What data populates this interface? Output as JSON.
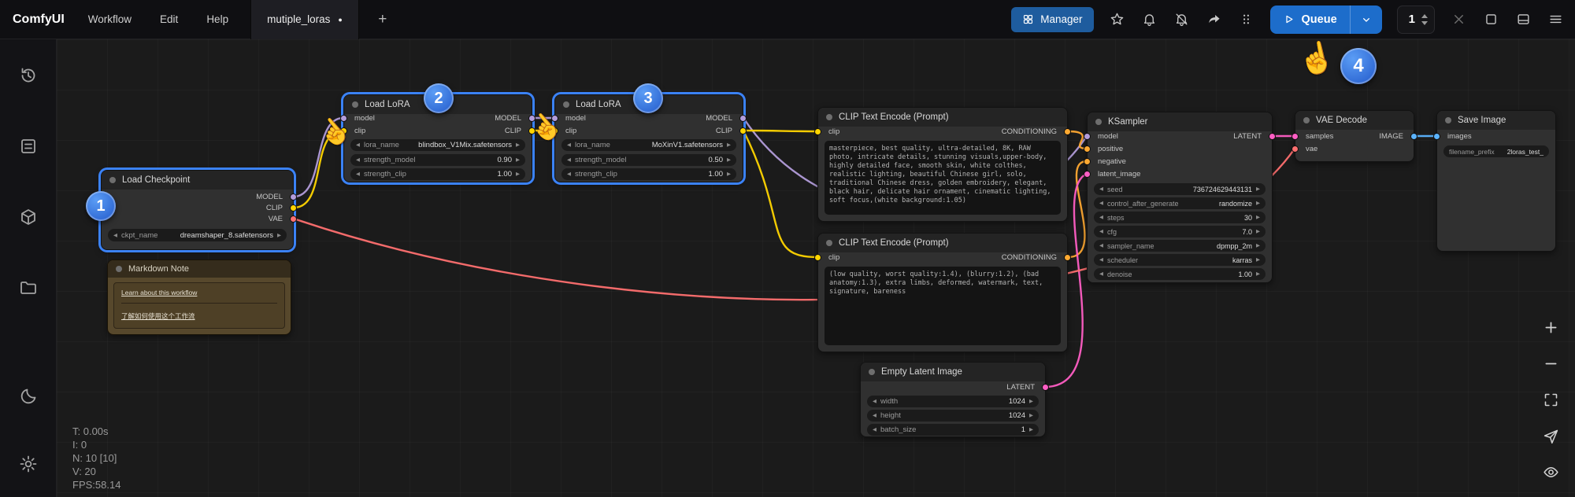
{
  "topbar": {
    "logo": "ComfyUI",
    "menus": [
      "Workflow",
      "Edit",
      "Help"
    ],
    "tab_label": "mutiple_loras",
    "tab_dirty_dot": "●",
    "new_tab_label": "+",
    "manager_label": "Manager",
    "queue_label": "Queue",
    "queue_count": "1"
  },
  "glyphs": {
    "arrow_left": "◀",
    "arrow_right": "▶",
    "hand_cursor": "☝"
  },
  "badges": [
    "1",
    "2",
    "3",
    "4"
  ],
  "stats": [
    "T: 0.00s",
    "I: 0",
    "N: 10 [10]",
    "V: 20",
    "FPS:58.14"
  ],
  "nodes": {
    "load_checkpoint": {
      "title": "Load Checkpoint",
      "outputs": [
        "MODEL",
        "CLIP",
        "VAE"
      ],
      "widgets": [
        {
          "name": "ckpt_name",
          "value": "dreamshaper_8.safetensors"
        }
      ]
    },
    "lora_1": {
      "title": "Load LoRA",
      "inputs": [
        "model",
        "clip"
      ],
      "outputs": [
        "MODEL",
        "CLIP"
      ],
      "widgets": [
        {
          "name": "lora_name",
          "value": "blindbox_V1Mix.safetensors"
        },
        {
          "name": "strength_model",
          "value": "0.90"
        },
        {
          "name": "strength_clip",
          "value": "1.00"
        }
      ]
    },
    "lora_2": {
      "title": "Load LoRA",
      "inputs": [
        "model",
        "clip"
      ],
      "outputs": [
        "MODEL",
        "CLIP"
      ],
      "widgets": [
        {
          "name": "lora_name",
          "value": "MoXinV1.safetensors"
        },
        {
          "name": "strength_model",
          "value": "0.50"
        },
        {
          "name": "strength_clip",
          "value": "1.00"
        }
      ]
    },
    "clip_positive": {
      "title": "CLIP Text Encode (Prompt)",
      "inputs": [
        "clip"
      ],
      "outputs": [
        "CONDITIONING"
      ],
      "text": "masterpiece, best quality, ultra-detailed, 8K, RAW photo, intricate details, stunning visuals,upper-body, highly detailed face, smooth skin, white colthes, realistic lighting, beautiful Chinese girl, solo, traditional Chinese dress, golden embroidery, elegant, black hair, delicate hair ornament, cinematic lighting, soft focus,(white background:1.05)"
    },
    "clip_negative": {
      "title": "CLIP Text Encode (Prompt)",
      "inputs": [
        "clip"
      ],
      "outputs": [
        "CONDITIONING"
      ],
      "text": "(low quality, worst quality:1.4), (blurry:1.2), (bad anatomy:1.3), extra limbs, deformed, watermark, text, signature, bareness"
    },
    "empty_latent": {
      "title": "Empty Latent Image",
      "outputs": [
        "LATENT"
      ],
      "widgets": [
        {
          "name": "width",
          "value": "1024"
        },
        {
          "name": "height",
          "value": "1024"
        },
        {
          "name": "batch_size",
          "value": "1"
        }
      ]
    },
    "ksampler": {
      "title": "KSampler",
      "inputs": [
        "model",
        "positive",
        "negative",
        "latent_image"
      ],
      "outputs": [
        "LATENT"
      ],
      "widgets": [
        {
          "name": "seed",
          "value": "736724629443131"
        },
        {
          "name": "control_after_generate",
          "value": "randomize"
        },
        {
          "name": "steps",
          "value": "30"
        },
        {
          "name": "cfg",
          "value": "7.0"
        },
        {
          "name": "sampler_name",
          "value": "dpmpp_2m"
        },
        {
          "name": "scheduler",
          "value": "karras"
        },
        {
          "name": "denoise",
          "value": "1.00"
        }
      ]
    },
    "vae_decode": {
      "title": "VAE Decode",
      "inputs": [
        "samples",
        "vae"
      ],
      "outputs": [
        "IMAGE"
      ]
    },
    "save_image": {
      "title": "Save Image",
      "inputs": [
        "images"
      ],
      "widgets": [
        {
          "name": "filename_prefix",
          "value": "2loras_test_"
        }
      ]
    },
    "markdown_note": {
      "title": "Markdown Note",
      "links": [
        "Learn about this workflow",
        "了解如何使用这个工作流"
      ]
    }
  },
  "colors": {
    "selection_highlight": "#3b82f6",
    "accent_blue": "#1d6dcb",
    "wire_model": "#b39ddb",
    "wire_clip": "#ffd500",
    "wire_vae": "#ff7070",
    "wire_conditioning": "#ffa931",
    "wire_latent": "#ff5ec4",
    "wire_image": "#5bb3ff",
    "note_brown": "#57482c",
    "badge_blue": "#2f6fe4"
  }
}
